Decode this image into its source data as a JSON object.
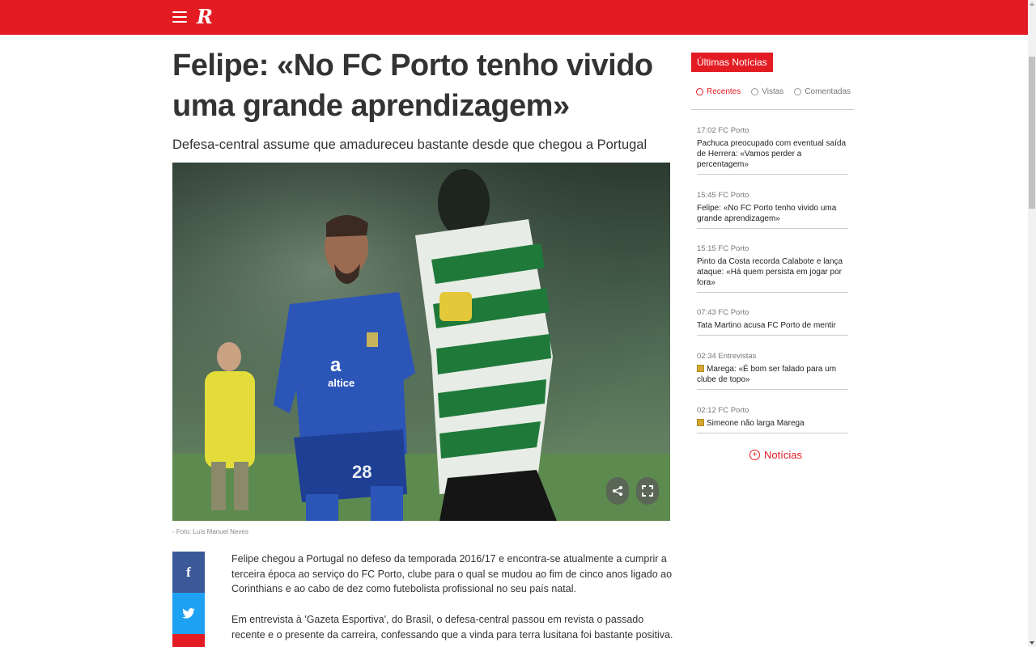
{
  "header": {
    "logo": "R",
    "brand_color": "#e31b23"
  },
  "article": {
    "title": "Felipe: «No FC Porto tenho vivido uma grande aprendizagem»",
    "subtitle": "Defesa-central assume que amadureceu bastante desde que chegou a Portugal",
    "photo_caption": "- Foto: Luís Manuel Neves",
    "paragraphs": [
      "Felipe chegou a Portugal no defeso da temporada 2016/17 e encontra-se atualmente a cumprir a terceira época ao serviço do FC Porto, clube para o qual se mudou ao fim de cinco anos ligado ao Corinthians e ao cabo de dez como futebolista profissional no seu país natal.",
      "Em entrevista à 'Gazeta Esportiva', do Brasil, o defesa-central passou em revista o passado recente e o presente da carreira, confessando que a vinda para terra lusitana foi bastante positiva."
    ],
    "social": {
      "facebook": "f",
      "colors": {
        "facebook": "#3b5998",
        "twitter": "#1da1f2"
      }
    },
    "photo_icons": [
      "share-icon",
      "fullscreen-icon"
    ]
  },
  "sidebar": {
    "title": "Últimas Notícias",
    "tabs": [
      {
        "label": "Recentes",
        "active": true
      },
      {
        "label": "Vistas",
        "active": false
      },
      {
        "label": "Comentadas",
        "active": false
      }
    ],
    "news": [
      {
        "time": "17:02",
        "category": "FC Porto",
        "title": "Pachuca preocupado com eventual saída de Herrera: «Vamos perder a percentagem»",
        "media": false
      },
      {
        "time": "15:45",
        "category": "FC Porto",
        "title": "Felipe: «No FC Porto tenho vivido uma grande aprendizagem»",
        "media": false
      },
      {
        "time": "15:15",
        "category": "FC Porto",
        "title": "Pinto da Costa recorda Calabote e lança ataque: «Há quem persista em jogar por fora»",
        "media": false
      },
      {
        "time": "07:43",
        "category": "FC Porto",
        "title": "Tata Martino acusa FC Porto de mentir",
        "media": false
      },
      {
        "time": "02:34",
        "category": "Entrevistas",
        "title": "Marega: «É bom ser falado para um clube de topo»",
        "media": true
      },
      {
        "time": "02:12",
        "category": "FC Porto",
        "title": "Simeone não larga Marega",
        "media": true
      }
    ],
    "more_label": "Notícias"
  }
}
